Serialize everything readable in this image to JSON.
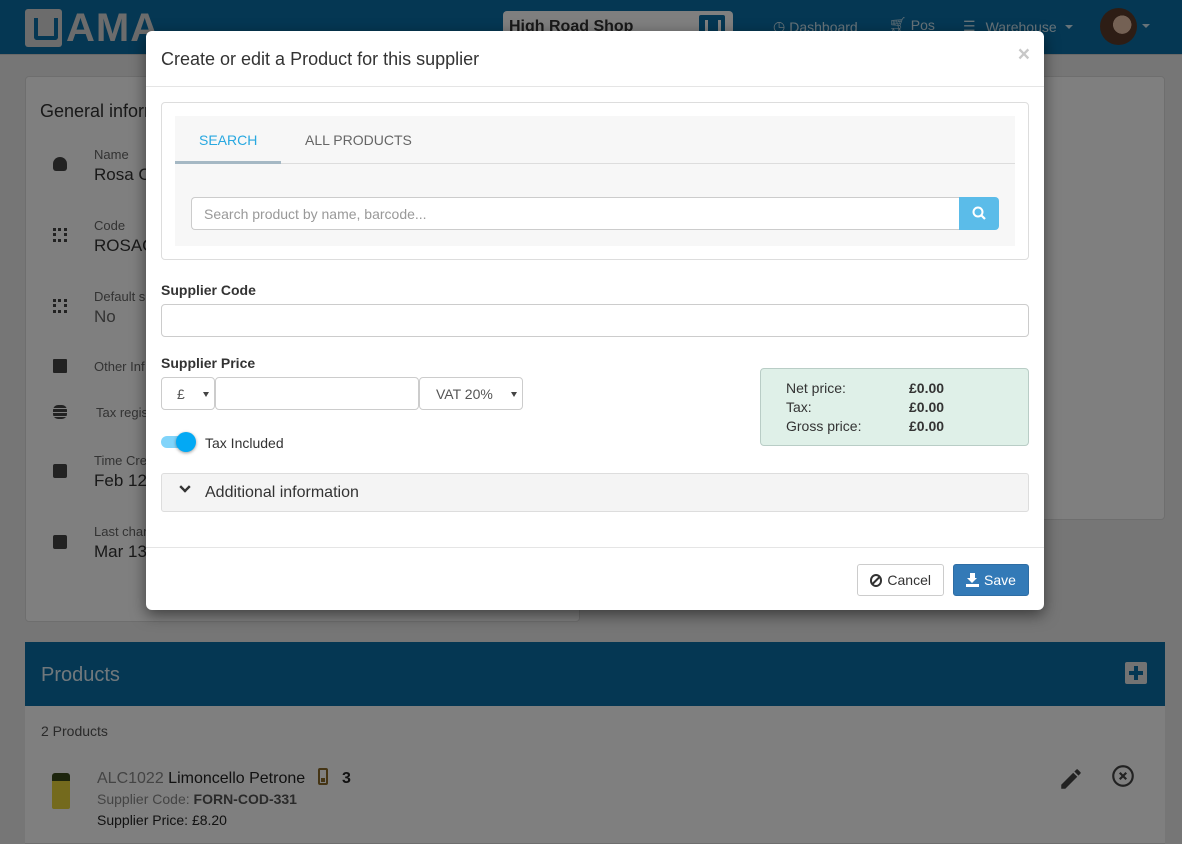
{
  "navbar": {
    "logo_text": "AMA",
    "shop": "High Road Shop",
    "items": [
      {
        "label": "Dashboard",
        "icon": "dashboard-icon"
      },
      {
        "label": "Pos",
        "icon": "cart-icon"
      },
      {
        "label": "Warehouse",
        "icon": "menu-icon",
        "dropdown": true
      }
    ]
  },
  "general_info": {
    "title": "General information",
    "fields": [
      {
        "label": "Name",
        "value": "Rosa C",
        "icon": "user-icon"
      },
      {
        "label": "Code",
        "value": "ROSAC",
        "icon": "qr-code-icon"
      },
      {
        "label": "Default s",
        "value": "No",
        "icon": "qr-code-icon"
      },
      {
        "label": "Other Inf",
        "value": "",
        "icon": "note-icon"
      },
      {
        "label": "Tax regis",
        "value": "",
        "icon": "coins-icon"
      },
      {
        "label": "Time Cre",
        "value": "Feb 12",
        "icon": "calendar-icon"
      },
      {
        "label": "Last chan",
        "value": "Mar 13",
        "icon": "calendar-icon"
      }
    ]
  },
  "products": {
    "title": "Products",
    "count_label": "2 Products",
    "items": [
      {
        "code": "ALC1022",
        "name": "Limoncello Petrone",
        "stock": "3",
        "supplier_code_label": "Supplier Code:",
        "supplier_code": "FORN-COD-331",
        "supplier_price_label": "Supplier Price:",
        "supplier_price": "£8.20"
      }
    ]
  },
  "modal": {
    "title": "Create or edit a Product for this supplier",
    "close": "×",
    "tabs": [
      {
        "label": "SEARCH",
        "active": true
      },
      {
        "label": "ALL PRODUCTS",
        "active": false
      }
    ],
    "search_placeholder": "Search product by name, barcode...",
    "supplier_code_label": "Supplier Code",
    "supplier_code_value": "",
    "supplier_price_label": "Supplier Price",
    "currency": "£",
    "price_value": "",
    "vat": "VAT 20%",
    "tax_included_label": "Tax Included",
    "tax_included": true,
    "summary": [
      {
        "label": "Net price:",
        "value": "£0.00"
      },
      {
        "label": "Tax:",
        "value": "£0.00"
      },
      {
        "label": "Gross price:",
        "value": "£0.00"
      }
    ],
    "additional_info_label": "Additional information",
    "cancel_label": "Cancel",
    "save_label": "Save"
  },
  "colors": {
    "brand": "#0a6fa6",
    "accent": "#28a8e0",
    "save": "#337ab7",
    "summary_bg": "#dff0e8"
  }
}
